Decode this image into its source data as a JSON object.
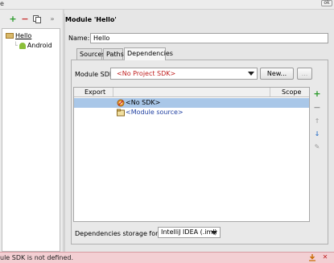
{
  "window": {
    "top_left_text": "e",
    "top_right_button": "ok"
  },
  "left_toolbar": {
    "add_icon": "+",
    "remove_icon": "−",
    "copy_icon": "copy",
    "collapse_icon": "»"
  },
  "tree": {
    "items": [
      {
        "label": "Hello"
      },
      {
        "label": "Android"
      }
    ]
  },
  "module": {
    "title": "Module 'Hello'",
    "name_label": "Name:",
    "name_value": "Hello",
    "tabs": [
      {
        "label": "Sources"
      },
      {
        "label": "Paths"
      },
      {
        "label": "Dependencies"
      }
    ],
    "sdk_label": "Module SDK:",
    "sdk_value": "<No Project SDK>",
    "new_button": "New...",
    "dots_button": "...",
    "table": {
      "headers": [
        "Export",
        "Scope"
      ],
      "rows": [
        {
          "label": "<No SDK>"
        },
        {
          "label": "<Module source>"
        }
      ]
    },
    "storage_label": "Dependencies storage format:",
    "storage_value": "IntelliJ IDEA (.iml)"
  },
  "right_tools": {
    "add": "+",
    "remove": "−",
    "up": "↑",
    "down": "↓",
    "edit": "✎"
  },
  "status": {
    "message": "ule SDK is not defined."
  },
  "colors": {
    "selection": "#a9c7e8",
    "status_bg": "#f3cfd3",
    "sdk_red": "#c02020",
    "add_green": "#2a9a2a",
    "remove_red": "#c83030"
  }
}
